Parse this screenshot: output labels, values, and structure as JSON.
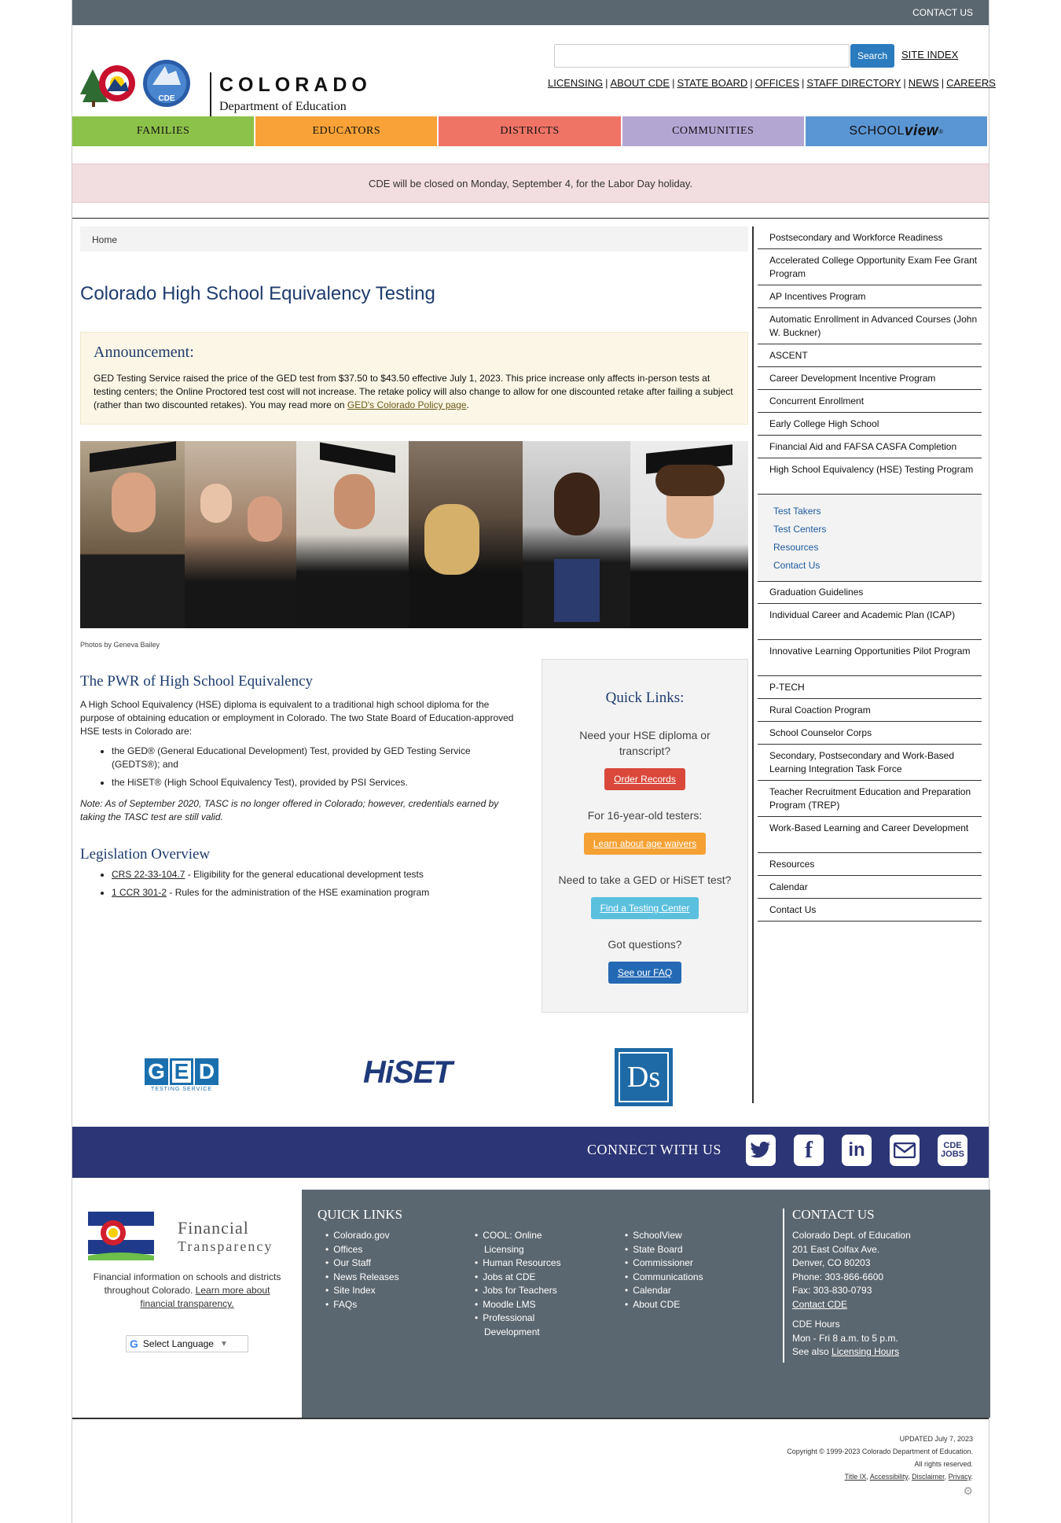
{
  "topbar": {
    "contact_label": "CONTACT US"
  },
  "header": {
    "logo_word": "COLORADO",
    "logo_dept": "Department of Education",
    "logo_badge": "CDE",
    "search_button": "Search",
    "search_placeholder": "",
    "site_index": "SITE INDEX",
    "util_links": [
      "LICENSING",
      "ABOUT CDE",
      "STATE BOARD",
      "OFFICES",
      "STAFF DIRECTORY",
      "NEWS",
      "CAREERS"
    ]
  },
  "nav": {
    "items": [
      {
        "label": "FAMILIES",
        "color": "#8dc24a"
      },
      {
        "label": "EDUCATORS",
        "color": "#f9a237"
      },
      {
        "label": "DISTRICTS",
        "color": "#ef7466"
      },
      {
        "label": "COMMUNITIES",
        "color": "#b3a6d3"
      },
      {
        "label": "SCHOOL",
        "color": "#5b96d4"
      }
    ],
    "schoolview_bold": "view"
  },
  "alert": {
    "text": "CDE will be closed on Monday, September 4, for the Labor Day holiday."
  },
  "breadcrumb": {
    "home": "Home"
  },
  "page_title": "Colorado High School Equivalency Testing",
  "announcement": {
    "title": "Announcement:",
    "body": "GED Testing Service raised the price of the GED test from $37.50 to $43.50 effective July 1, 2023. This price increase only affects in-person tests at testing centers; the Online Proctored test cost will not increase. The retake policy will also change to allow for one discounted retake after failing a subject (rather than two discounted retakes). You may read more on ",
    "link": "GED's Colorado Policy page",
    "end": "."
  },
  "photo_caption": "Photos by Geneva Bailey",
  "pwr": {
    "title": "The PWR of High School Equivalency",
    "intro": "A High School Equivalency (HSE) diploma is equivalent to a traditional high school diploma for the purpose of obtaining education or employment in Colorado. The two State Board of Education-approved HSE tests in Colorado are:",
    "items": [
      "the GED® (General Educational Development) Test, provided by GED Testing Service (GEDTS®); and",
      "the HiSET® (High School Equivalency Test), provided by PSI Services."
    ],
    "note": "Note: As of September 2020, TASC is no longer offered in Colorado; however, credentials earned by taking the TASC test are still valid."
  },
  "legislation": {
    "title": "Legislation Overview",
    "items": [
      {
        "link": "CRS 22-33-104.7",
        "text": " - Eligibility for the general educational development tests"
      },
      {
        "link": "1 CCR 301-2",
        "text": " - Rules for the administration of the HSE examination program"
      }
    ]
  },
  "quick_links_box": {
    "title": "Quick Links:",
    "q1": "Need your HSE diploma or transcript?",
    "b1": "Order Records",
    "q2": "For 16-year-old testers:",
    "b2": "Learn about age waivers",
    "q3": "Need to take a GED or HiSET test?",
    "b3": "Find a Testing Center",
    "q4": "Got questions?",
    "b4": "See our FAQ"
  },
  "partner_logos": {
    "ged_letters": [
      "G",
      "E",
      "D"
    ],
    "ged_sub": "TESTING SERVICE",
    "hiset": "HiSET",
    "ds": "Ds"
  },
  "sidebar": {
    "items_top": [
      "Postsecondary and Workforce Readiness",
      "Accelerated College Opportunity Exam Fee Grant Program",
      "AP Incentives Program",
      "Automatic Enrollment in Advanced Courses (John W. Buckner)",
      "ASCENT",
      "Career Development Incentive Program",
      "Concurrent Enrollment",
      "Early College High School",
      "Financial Aid and FAFSA CASFA Completion",
      "High School Equivalency (HSE) Testing Program"
    ],
    "sub_items": [
      "Test Takers",
      "Test Centers",
      "Resources",
      "Contact Us"
    ],
    "items_bottom": [
      "Graduation Guidelines",
      "Individual Career and Academic Plan (ICAP)",
      "Innovative Learning Opportunities Pilot Program",
      "P-TECH",
      "Rural Coaction Program",
      "School Counselor Corps",
      "Secondary, Postsecondary and Work-Based Learning Integration Task Force",
      "Teacher Recruitment Education and Preparation Program (TREP)",
      "Work-Based Learning and Career Development",
      "Resources",
      "Calendar",
      "Contact Us"
    ]
  },
  "connect": {
    "title": "CONNECT WITH US",
    "icons": [
      "twitter-icon",
      "facebook-icon",
      "linkedin-icon",
      "email-icon",
      "cde-jobs-icon"
    ],
    "jobs_label_1": "CDE",
    "jobs_label_2": "JOBS"
  },
  "footer": {
    "ft_title_1": "Financial",
    "ft_title_2": "Transparency",
    "ft_text": "Financial information on schools and districts throughout Colorado. ",
    "ft_link": "Learn more about financial transparency.",
    "lang": "Select Language",
    "quick_title": "QUICK LINKS",
    "col1": [
      "Colorado.gov",
      "Offices",
      "Our Staff",
      "News Releases",
      "Site Index",
      "FAQs"
    ],
    "col2": [
      "COOL: Online Licensing",
      "Human Resources",
      "Jobs at CDE",
      "Jobs for Teachers",
      "Moodle LMS",
      "Professional Development"
    ],
    "col3": [
      "SchoolView",
      "State Board",
      "Commissioner",
      "Communications",
      "Calendar",
      "About CDE"
    ],
    "contact_title": "CONTACT US",
    "contact_lines": [
      "Colorado Dept. of Education",
      "201 East Colfax Ave.",
      "Denver, CO 80203",
      "Phone: 303-866-6600",
      "Fax: 303-830-0793"
    ],
    "contact_link": "Contact CDE",
    "hours_title": "CDE Hours",
    "hours": "Mon - Fri 8 a.m. to 5 p.m.",
    "see_also": "See also ",
    "licensing_hours": "Licensing Hours"
  },
  "legal": {
    "updated": "UPDATED July 7, 2023",
    "copyright": "Copyright © 1999-2023 Colorado Department of Education.",
    "rights": "All rights reserved.",
    "links": [
      "Title IX",
      "Accessibility",
      "Disclaimer",
      "Privacy"
    ]
  }
}
